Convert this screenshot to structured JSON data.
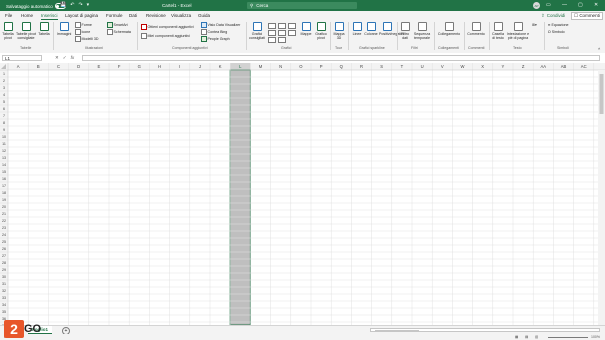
{
  "titlebar": {
    "autosave_label": "Salvataggio automatico",
    "autosave_state": "off",
    "doc_title": "Cartel1  -  Excel",
    "search_placeholder": "Cerca",
    "user_initials": "AP",
    "bg_color": "#217346"
  },
  "tabs": [
    "File",
    "Home",
    "Inserisci",
    "Layout di pagina",
    "Formule",
    "Dati",
    "Revisione",
    "Visualizza",
    "Guida"
  ],
  "active_tab": "Inserisci",
  "share_label": "Condividi",
  "comments_label": "Commenti",
  "ribbon": {
    "tabelle": {
      "label": "Tabelle",
      "buttons": [
        "Tabella pivot",
        "Tabelle pivot consigliate",
        "Tabella"
      ]
    },
    "illustrazioni": {
      "label": "Illustrazioni",
      "big": "Immagini",
      "small": [
        "Forme",
        "Icone",
        "Modelli 3D",
        "SmartArt",
        "Schermata"
      ]
    },
    "componenti": {
      "label": "Componenti aggiuntivi",
      "items": [
        "Ottieni componenti aggiuntivi",
        "Miei componenti aggiuntivi",
        "Visio Data Visualizer",
        "Contea Bing",
        "People Graph"
      ]
    },
    "grafici": {
      "label": "Grafici",
      "buttons": [
        "Grafici consigliati",
        "Mappe",
        "Grafico pivot"
      ]
    },
    "tour": {
      "label": "Tour",
      "button": "Mappa 3D"
    },
    "sparkline": {
      "label": "Grafici sparkline",
      "buttons": [
        "Linee",
        "Colonne",
        "Positivi/negativi"
      ]
    },
    "filtri": {
      "label": "Filtri",
      "buttons": [
        "Filtro dati",
        "Sequenza temporale"
      ]
    },
    "collegamenti": {
      "label": "Collegamenti",
      "button": "Collegamento"
    },
    "commenti": {
      "label": "Commenti",
      "button": "Commento"
    },
    "testo": {
      "label": "Testo",
      "buttons": [
        "Casella di testo",
        "Intestazione e piè di pagina"
      ]
    },
    "simboli": {
      "label": "Simboli",
      "items": [
        "Equazione",
        "Simbolo"
      ]
    }
  },
  "formula_bar": {
    "namebox": "L1",
    "fx": "fx",
    "value": ""
  },
  "grid": {
    "columns": [
      "A",
      "B",
      "C",
      "D",
      "E",
      "F",
      "G",
      "H",
      "I",
      "J",
      "K",
      "L",
      "M",
      "N",
      "O",
      "P",
      "Q",
      "R",
      "S",
      "T",
      "U",
      "V",
      "W",
      "X",
      "Y",
      "Z",
      "AA",
      "AB",
      "AC"
    ],
    "row_count": 37,
    "selected_column": "L"
  },
  "sheet": {
    "tab_label": "Foglio1"
  },
  "status": {
    "left": "Pronto",
    "zoom": "100%"
  },
  "watermark": "2GO"
}
